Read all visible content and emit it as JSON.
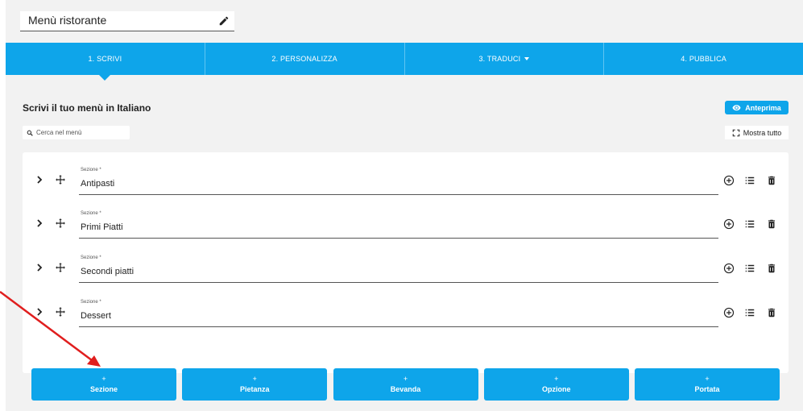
{
  "menu": {
    "title": "Menù ristorante"
  },
  "steps": [
    {
      "label": "1. SCRIVI",
      "active": true
    },
    {
      "label": "2. PERSONALIZZA"
    },
    {
      "label": "3. TRADUCI",
      "has_dropdown": true
    },
    {
      "label": "4. PUBBLICA"
    }
  ],
  "editor": {
    "heading": "Scrivi il tuo menù in Italiano",
    "preview_label": "Anteprima",
    "search_placeholder": "Cerca nel menù",
    "show_all_label": "Mostra tutto"
  },
  "sections": [
    {
      "label": "Sezione *",
      "value": "Antipasti"
    },
    {
      "label": "Sezione *",
      "value": "Primi Piatti"
    },
    {
      "label": "Sezione *",
      "value": "Secondi piatti"
    },
    {
      "label": "Sezione *",
      "value": "Dessert"
    }
  ],
  "add_buttons": [
    {
      "plus": "+",
      "label": "Sezione"
    },
    {
      "plus": "+",
      "label": "Pietanza"
    },
    {
      "plus": "+",
      "label": "Bevanda"
    },
    {
      "plus": "+",
      "label": "Opzione"
    },
    {
      "plus": "+",
      "label": "Portata"
    }
  ],
  "colors": {
    "accent": "#0ea5ea",
    "annotation_arrow": "#e01e1e"
  },
  "icons": [
    "pencil-icon",
    "eye-icon",
    "search-icon",
    "fullscreen-icon",
    "chevron-right-icon",
    "move-icon",
    "add-circle-icon",
    "list-icon",
    "trash-icon"
  ]
}
